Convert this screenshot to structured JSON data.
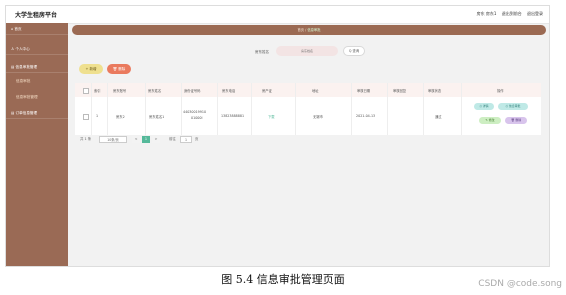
{
  "app": {
    "title": "大学生租房平台"
  },
  "header": {
    "user": "房东 房东1",
    "back_to_front": "退出到前台",
    "logout": "退出登录"
  },
  "sidebar": {
    "items": [
      {
        "label": "⌂ 首页"
      },
      {
        "label": "♙ 个人中心"
      },
      {
        "label": "▤ 信息审批管理"
      },
      {
        "label": "▤ 订单信息管理"
      }
    ],
    "subitems": [
      {
        "label": "信息审批"
      },
      {
        "label": "信息审批管理"
      }
    ]
  },
  "breadcrumb": {
    "home": "首页",
    "sep": "/",
    "current": "信息审批"
  },
  "search": {
    "label": "房东姓名",
    "placeholder": "房东姓名",
    "button": "Q 查询"
  },
  "toolbar": {
    "add": "+ 新增",
    "delete": "🗑 删除"
  },
  "table": {
    "columns": [
      "索引",
      "房东账号",
      "房东姓名",
      "身份证号码",
      "房东电话",
      "房产证",
      "地址",
      "审核日期",
      "审核回复",
      "审核状态",
      "操作"
    ],
    "rows": [
      {
        "index": "1",
        "account": "房东2",
        "name": "房东姓名1",
        "id_line1": "44030019910",
        "id_line2": "01000I",
        "phone": "13823888881",
        "deed": "下载",
        "address": "无锡市",
        "date": "2021-04-13",
        "reply": "",
        "status": "通过",
        "ops": {
          "detail": "详情",
          "approve": "信息审批",
          "edit": "修改",
          "delete": "删除"
        }
      }
    ]
  },
  "pagination": {
    "total": "共 1 条",
    "page_size": "10条/页",
    "prev": "<",
    "pages": [
      "1"
    ],
    "next": ">",
    "goto_label": "前往",
    "goto_value": "1",
    "goto_suffix": "页"
  },
  "figure": {
    "caption": "图 5.4  信息审批管理页面",
    "watermark": "CSDN @code.song"
  },
  "colors": {
    "sidebar": "#9a6a55",
    "breadcrumb": "#9b6a53",
    "accent_green": "#55b99a",
    "add": "#efe08f",
    "delete": "#ea7a5e"
  }
}
